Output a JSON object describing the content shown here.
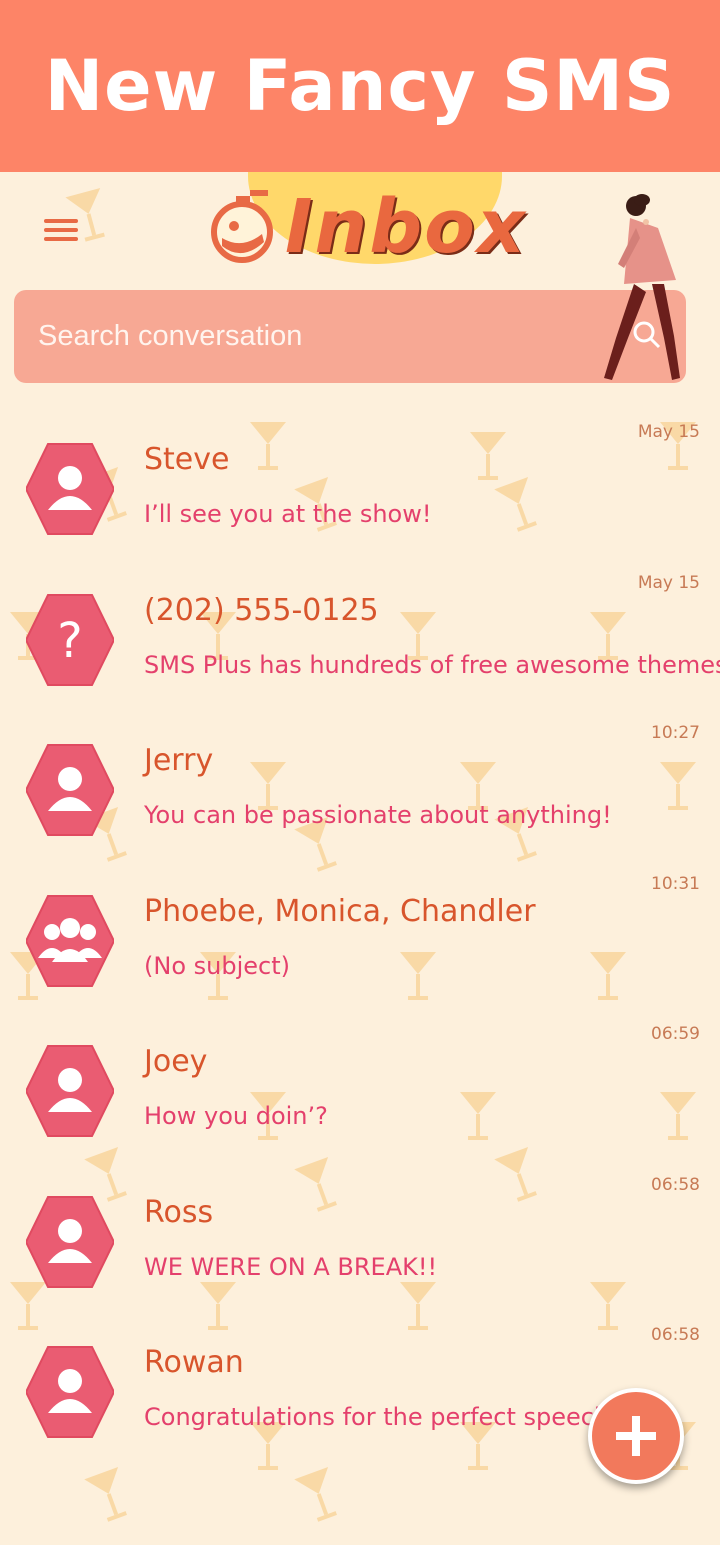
{
  "banner": {
    "title": "New Fancy SMS"
  },
  "header": {
    "title": "Inbox",
    "menu_icon": "hamburger-menu-icon"
  },
  "search": {
    "placeholder": "Search conversation"
  },
  "conversations": [
    {
      "name": "Steve",
      "preview": "I’ll see you at the show!",
      "time": "May 15",
      "avatar": "person"
    },
    {
      "name": "(202) 555-0125",
      "preview": "SMS Plus has hundreds of free awesome themes",
      "time": "May 15",
      "avatar": "unknown"
    },
    {
      "name": "Jerry",
      "preview": " You can be passionate about anything!",
      "time": "10:27",
      "avatar": "person"
    },
    {
      "name": "Phoebe, Monica, Chandler",
      "preview": "(No subject)",
      "time": "10:31",
      "avatar": "group"
    },
    {
      "name": "Joey",
      "preview": "How you doin’?",
      "time": "06:59",
      "avatar": "person"
    },
    {
      "name": "Ross",
      "preview": "WE WERE ON A BREAK!!",
      "time": "06:58",
      "avatar": "person"
    },
    {
      "name": "Rowan",
      "preview": "Congratulations for the perfect speech he",
      "time": "06:58",
      "avatar": "person"
    }
  ],
  "fab": {
    "icon": "plus-icon"
  },
  "colors": {
    "banner": "#fd8467",
    "background": "#fdf0dc",
    "avatar": "#ea5c72",
    "name": "#d8552c",
    "preview": "#e4406c"
  }
}
